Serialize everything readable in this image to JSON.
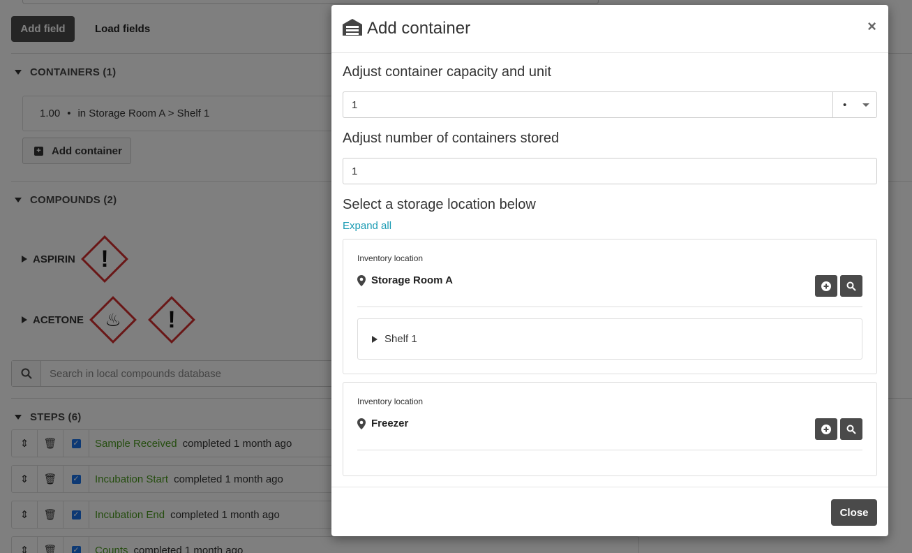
{
  "background": {
    "add_field_label": "Add field",
    "load_fields_label": "Load fields",
    "containers_title": "CONTAINERS (1)",
    "container_row": {
      "quantity": "1.00",
      "bullet": "•",
      "location": "in Storage Room A > Shelf 1"
    },
    "add_container_label": "Add container",
    "compounds_title": "COMPOUNDS (2)",
    "compounds": [
      {
        "name": "ASPIRIN"
      },
      {
        "name": "ACETONE"
      }
    ],
    "search_placeholder": "Search in local compounds database",
    "steps_title": "STEPS (6)",
    "steps": [
      {
        "name": "Sample Received",
        "meta": "completed 1 month ago"
      },
      {
        "name": "Incubation Start",
        "meta": "completed 1 month ago"
      },
      {
        "name": "Incubation End",
        "meta": "completed 1 month ago"
      },
      {
        "name": "Counts",
        "meta": "completed 1 month ago"
      }
    ]
  },
  "modal": {
    "title": "Add container",
    "close_symbol": "×",
    "capacity_label": "Adjust container capacity and unit",
    "capacity_value": "1",
    "unit_value": "•",
    "number_label": "Adjust number of containers stored",
    "number_value": "1",
    "location_label": "Select a storage location below",
    "expand_all": "Expand all",
    "locations": [
      {
        "type_label": "Inventory location",
        "name": "Storage Room A",
        "children": [
          {
            "name": "Shelf 1"
          }
        ]
      },
      {
        "type_label": "Inventory location",
        "name": "Freezer",
        "children": []
      }
    ],
    "footer_close": "Close"
  },
  "colors": {
    "accent_link": "#1a9bb3",
    "step_name": "#4a9a1f",
    "dark_button": "#4a4a4a",
    "hazard_red": "#d32f2f"
  }
}
